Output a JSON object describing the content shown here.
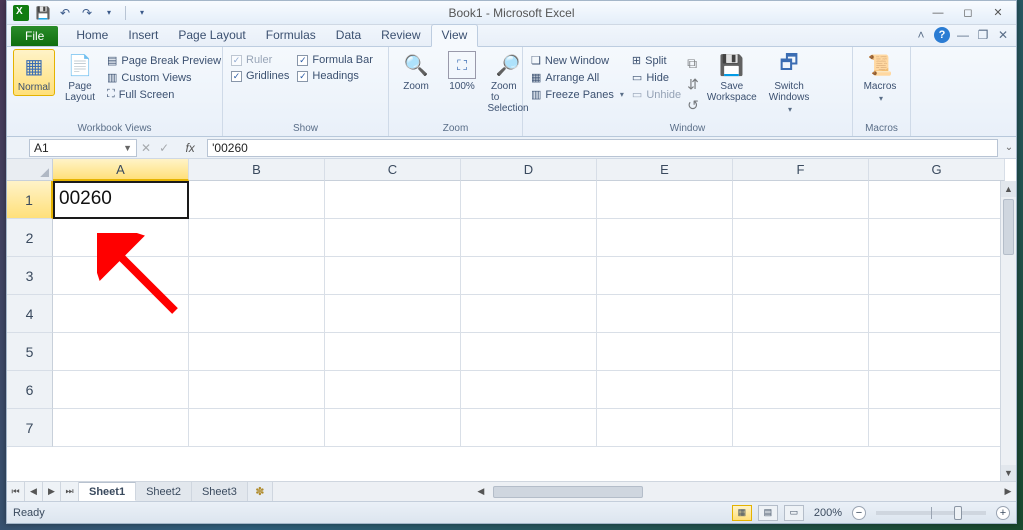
{
  "title": "Book1 - Microsoft Excel",
  "qat": {
    "save": "save",
    "undo": "undo",
    "redo": "redo"
  },
  "menu": {
    "file": "File",
    "tabs": [
      "Home",
      "Insert",
      "Page Layout",
      "Formulas",
      "Data",
      "Review",
      "View"
    ],
    "active": "View"
  },
  "ribbon": {
    "workbook_views": {
      "label": "Workbook Views",
      "normal": "Normal",
      "page_layout": "Page Layout",
      "page_break": "Page Break Preview",
      "custom": "Custom Views",
      "full": "Full Screen"
    },
    "show": {
      "label": "Show",
      "ruler": "Ruler",
      "formula_bar": "Formula Bar",
      "gridlines": "Gridlines",
      "headings": "Headings"
    },
    "zoom": {
      "label": "Zoom",
      "zoom": "Zoom",
      "hundred": "100%",
      "selection_l1": "Zoom to",
      "selection_l2": "Selection"
    },
    "window": {
      "label": "Window",
      "new": "New Window",
      "arrange": "Arrange All",
      "freeze": "Freeze Panes",
      "split": "Split",
      "hide": "Hide",
      "unhide": "Unhide",
      "save_ws_l1": "Save",
      "save_ws_l2": "Workspace",
      "switch_l1": "Switch",
      "switch_l2": "Windows"
    },
    "macros": {
      "label": "Macros",
      "btn": "Macros"
    }
  },
  "namebox": "A1",
  "formula": "'00260",
  "columns": [
    "A",
    "B",
    "C",
    "D",
    "E",
    "F",
    "G"
  ],
  "rows": [
    "1",
    "2",
    "3",
    "4",
    "5",
    "6",
    "7"
  ],
  "cellA1": "00260",
  "sheets": {
    "s1": "Sheet1",
    "s2": "Sheet2",
    "s3": "Sheet3"
  },
  "status": "Ready",
  "zoom": "200%"
}
